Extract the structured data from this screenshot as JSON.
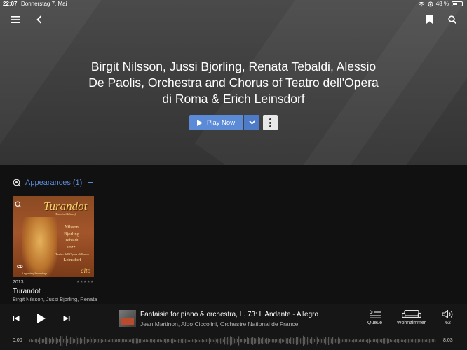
{
  "statusbar": {
    "time": "22:07",
    "date": "Donnerstag 7. Mai",
    "battery": "48 %",
    "battery_level": 0.48
  },
  "artist": {
    "name_lines": [
      "Birgit Nilsson, Jussi Bjorling, Renata Tebaldi, Alessio",
      "De Paolis, Orchestra and Chorus of Teatro dell'Opera",
      "di Roma & Erich Leinsdorf"
    ]
  },
  "actions": {
    "play_label": "Play Now"
  },
  "section": {
    "label": "Appearances (1)"
  },
  "album": {
    "year": "2013",
    "title": "Turandot",
    "artists": "Birgit Nilsson, Jussi Bjorling, Renata Tebaldi",
    "rating": "★★★★★",
    "cover": {
      "title": "Turandot",
      "subtitle": "(Puccini/Alfano)",
      "cast": [
        "Nilsson",
        "Bjorling",
        "Tebaldi",
        "Tozzi"
      ],
      "house": "Teatro dell'Opera di Roma",
      "conductor": "Leinsdorf",
      "format": "CD",
      "brand": "alto",
      "series": "Legendary Recordings"
    }
  },
  "player": {
    "track_title": "Fantaisie for piano & orchestra, L. 73: I. Andante - Allegro",
    "track_artists": "Jean Martinon, Aldo Ciccolini, Orchestre National de France",
    "queue_label": "Queue",
    "zone_label": "Wohnzimmer",
    "volume": "62",
    "elapsed": "0:00",
    "duration": "8:03"
  },
  "colors": {
    "accent": "#5b8ad6",
    "background": "#111111",
    "hero": "#404040"
  }
}
